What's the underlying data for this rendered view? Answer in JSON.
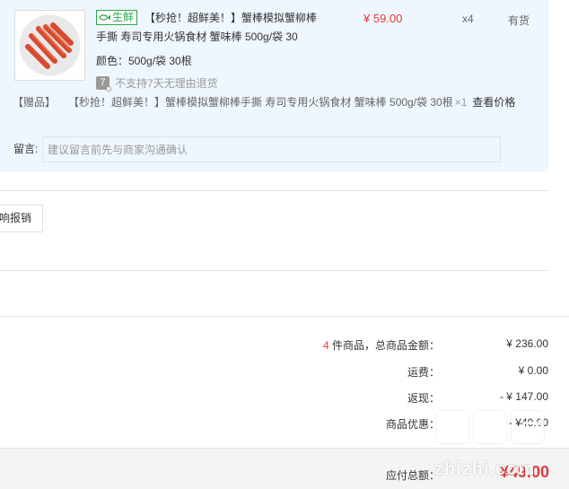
{
  "item": {
    "fresh_tag": "生鲜",
    "title": "【秒抢！超鲜美！】蟹棒模拟蟹柳棒手撕 寿司专用火锅食材 蟹味棒 500g/袋 30",
    "price": "¥ 59.00",
    "quantity": "x4",
    "stock_status": "有货",
    "color_spec": "颜色：500g/袋 30根",
    "return_policy": "不支持7天无理由退货",
    "return_icon_glyph": "7"
  },
  "gift": {
    "tag": "【赠品】",
    "name": "【秒抢！超鲜美！】蟹棒模拟蟹柳棒手撕 寿司专用火锅食材 蟹味棒 500g/袋 30根",
    "qty": "×1",
    "check_price": "查看价格"
  },
  "message": {
    "label": "留言:",
    "placeholder": "建议留言前先与商家沟通确认"
  },
  "report_button": "响报销",
  "summary": {
    "count": "4",
    "goods_label": "件商品，总商品金额：",
    "goods_total": "¥ 236.00",
    "shipping_label": "运费：",
    "shipping": "¥ 0.00",
    "cashback_label": "返现：",
    "cashback": "- ¥ 147.00",
    "discount_label": "商品优惠：",
    "discount": "- ¥40.00",
    "payable_label": "应付总额：",
    "payable": "¥49.00"
  },
  "watermark": {
    "text": "zhizhi.com"
  },
  "colors": {
    "accent_red": "#e4393c",
    "fresh_green": "#2aa84a",
    "panel_bg": "#eef7fd"
  }
}
